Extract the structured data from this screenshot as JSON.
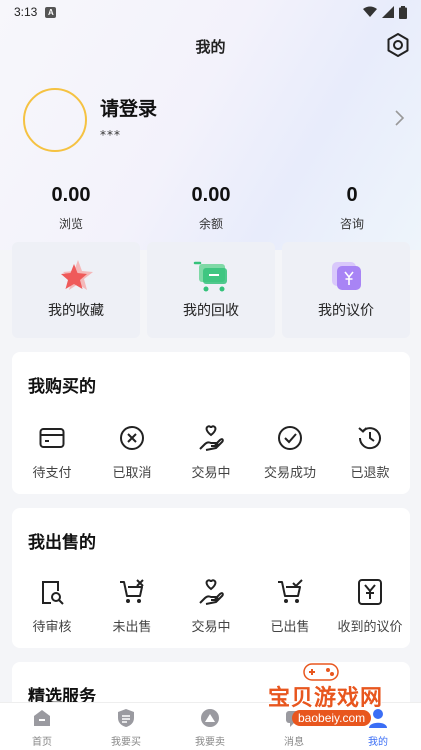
{
  "status_bar": {
    "time": "3:13",
    "notification_glyph": "A"
  },
  "header": {
    "title": "我的"
  },
  "profile": {
    "login_label": "请登录",
    "subtitle": "***"
  },
  "stats": [
    {
      "value": "0.00",
      "label": "浏览"
    },
    {
      "value": "0.00",
      "label": "余额"
    },
    {
      "value": "0",
      "label": "咨询"
    }
  ],
  "quick_cards": [
    {
      "label": "我的收藏",
      "icon": "star-icon"
    },
    {
      "label": "我的回收",
      "icon": "cart-icon"
    },
    {
      "label": "我的议价",
      "icon": "yen-tag-icon"
    }
  ],
  "buy_section": {
    "title": "我购买的",
    "items": [
      {
        "label": "待支付",
        "icon": "card-icon"
      },
      {
        "label": "已取消",
        "icon": "cancel-circle-icon"
      },
      {
        "label": "交易中",
        "icon": "hand-heart-icon"
      },
      {
        "label": "交易成功",
        "icon": "check-circle-icon"
      },
      {
        "label": "已退款",
        "icon": "history-icon"
      }
    ]
  },
  "sell_section": {
    "title": "我出售的",
    "items": [
      {
        "label": "待审核",
        "icon": "doc-search-icon"
      },
      {
        "label": "未出售",
        "icon": "cart-x-icon"
      },
      {
        "label": "交易中",
        "icon": "hand-heart-icon"
      },
      {
        "label": "已出售",
        "icon": "cart-check-icon"
      },
      {
        "label": "收到的议价",
        "icon": "yen-box-icon"
      }
    ]
  },
  "services_section": {
    "title": "精选服务"
  },
  "tabbar": [
    {
      "label": "首页",
      "icon": "home-icon"
    },
    {
      "label": "我要买",
      "icon": "shield-list-icon"
    },
    {
      "label": "我要卖",
      "icon": "bag-icon"
    },
    {
      "label": "消息",
      "icon": "message-icon"
    },
    {
      "label": "我的",
      "icon": "user-icon",
      "active": true
    }
  ],
  "watermark": {
    "text": "宝贝游戏网",
    "url": "baobeiy.com"
  },
  "colors": {
    "accent": "#3b6ef5",
    "avatar_ring": "#f5c242",
    "watermark": "#e8561e"
  }
}
